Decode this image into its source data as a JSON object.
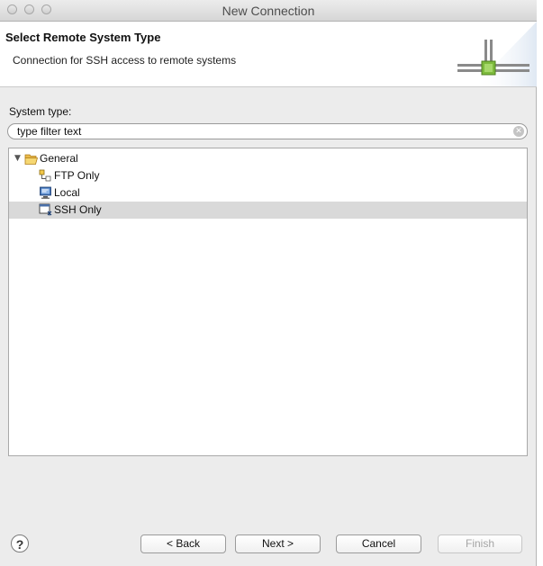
{
  "window": {
    "title": "New Connection"
  },
  "header": {
    "title": "Select Remote System Type",
    "description": "Connection for SSH access to remote systems",
    "graphic": "network-connection-icon"
  },
  "system_type": {
    "label": "System type:",
    "filter_value": "type filter text"
  },
  "tree": {
    "items": [
      {
        "label": "General",
        "icon": "folder-open-icon",
        "expanded": true,
        "selected": false
      },
      {
        "label": "FTP Only",
        "icon": "ftp-icon",
        "selected": false
      },
      {
        "label": "Local",
        "icon": "monitor-icon",
        "selected": false
      },
      {
        "label": "SSH Only",
        "icon": "ssh-icon",
        "selected": true
      }
    ]
  },
  "buttons": {
    "help": "?",
    "back": "< Back",
    "next": "Next >",
    "cancel": "Cancel",
    "finish": "Finish"
  },
  "colors": {
    "selection": "#d9d9d9",
    "accent_green": "#7dbb3c"
  }
}
